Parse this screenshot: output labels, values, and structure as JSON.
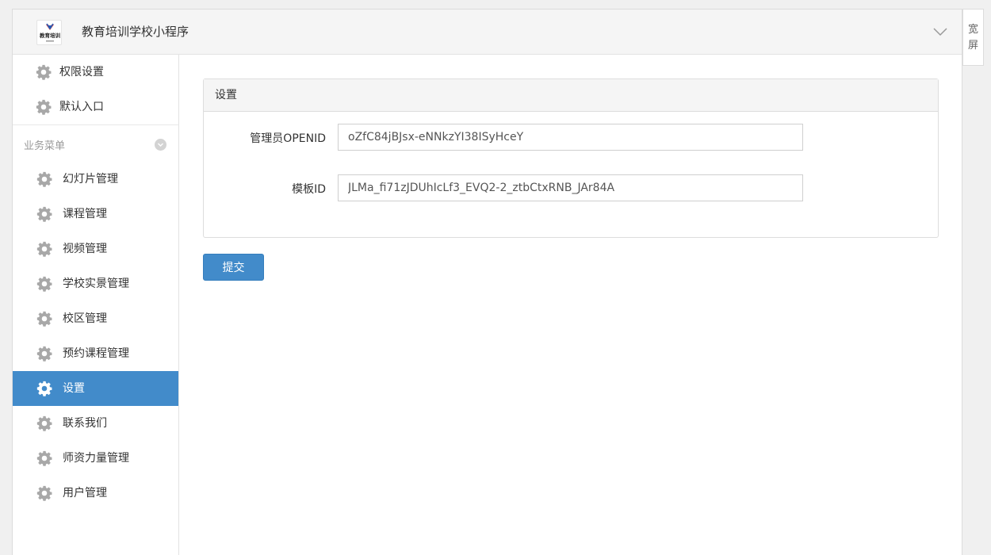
{
  "header": {
    "app_title": "教育培训学校小程序",
    "logo_text": "教育培训",
    "widescreen": [
      "宽",
      "屏"
    ]
  },
  "sidebar": {
    "top_items": [
      {
        "label": "权限设置",
        "icon": "gear-icon"
      },
      {
        "label": "默认入口",
        "icon": "gear-icon"
      }
    ],
    "section_title": "业务菜单",
    "items": [
      {
        "label": "幻灯片管理",
        "icon": "gear-icon"
      },
      {
        "label": "课程管理",
        "icon": "gear-icon"
      },
      {
        "label": "视频管理",
        "icon": "gear-icon"
      },
      {
        "label": "学校实景管理",
        "icon": "gear-icon"
      },
      {
        "label": "校区管理",
        "icon": "gear-icon"
      },
      {
        "label": "预约课程管理",
        "icon": "gear-icon"
      },
      {
        "label": "设置",
        "icon": "gear-icon",
        "active": true
      },
      {
        "label": "联系我们",
        "icon": "gear-icon"
      },
      {
        "label": "师资力量管理",
        "icon": "gear-icon"
      },
      {
        "label": "用户管理",
        "icon": "gear-icon"
      }
    ]
  },
  "main": {
    "panel_title": "设置",
    "fields": [
      {
        "label": "管理员OPENID",
        "value": "oZfC84jBJsx-eNNkzYI38ISyHceY"
      },
      {
        "label": "模板ID",
        "value": "JLMa_fi71zJDUhIcLf3_EVQ2-2_ztbCtxRNB_JAr84A"
      }
    ],
    "submit_label": "提交"
  },
  "colors": {
    "accent": "#428bca",
    "icon_gray": "#a8a8a8"
  }
}
